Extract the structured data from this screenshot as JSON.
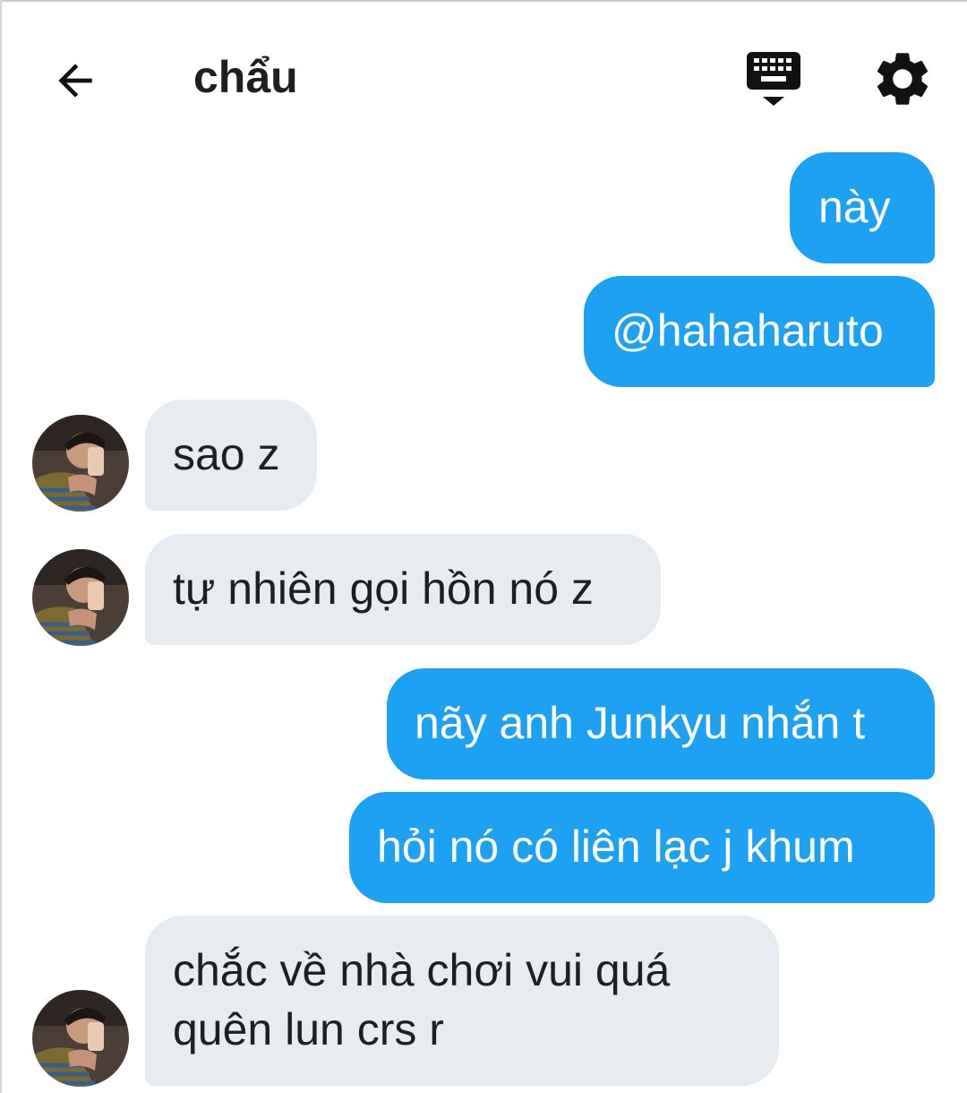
{
  "header": {
    "title": "chẩu",
    "back_icon": "arrow-left-icon",
    "keyboard_icon": "keyboard-hide-icon",
    "settings_icon": "gear-icon"
  },
  "colors": {
    "outgoing_bubble": "#1da1f2",
    "incoming_bubble": "#e6ecf0",
    "text_dark": "#1f1f1f"
  },
  "messages": [
    {
      "direction": "outgoing",
      "text": "này"
    },
    {
      "direction": "outgoing",
      "text": "@hahaharuto"
    },
    {
      "direction": "incoming",
      "text": "sao z"
    },
    {
      "direction": "incoming",
      "text": "tự nhiên gọi hồn nó z"
    },
    {
      "direction": "outgoing",
      "text": "nãy anh Junkyu nhắn t"
    },
    {
      "direction": "outgoing",
      "text": "hỏi nó có liên lạc j khum"
    },
    {
      "direction": "incoming",
      "lines": [
        "chắc về nhà chơi vui quá",
        "quên lun crs r"
      ]
    }
  ]
}
